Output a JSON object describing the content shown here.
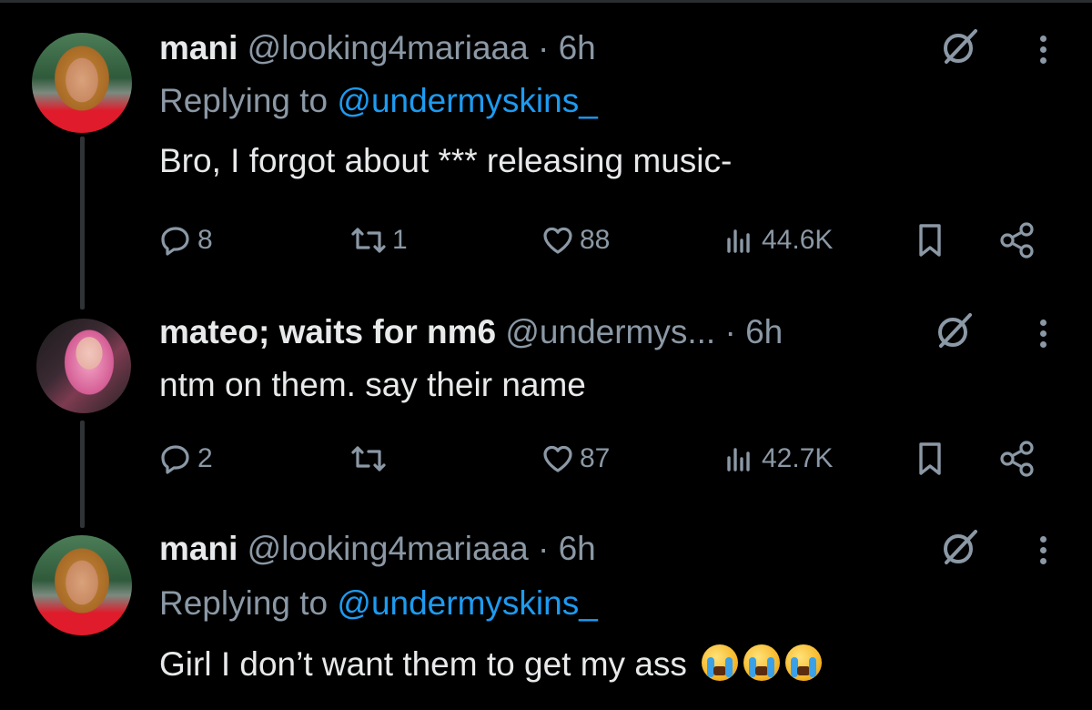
{
  "tweets": [
    {
      "name": "mani",
      "handle": "@looking4mariaaa",
      "dot": "·",
      "time": "6h",
      "replying_prefix": "Replying to",
      "replying_to": "@undermyskins_",
      "text": "Bro, I forgot about *** releasing music-",
      "replies": "8",
      "reposts": "1",
      "likes": "88",
      "views": "44.6K"
    },
    {
      "name": "mateo; waits for nm6",
      "handle": "@undermys...",
      "dot": "·",
      "time": "6h",
      "text": "ntm on them. say their name",
      "replies": "2",
      "reposts": "",
      "likes": "87",
      "views": "42.7K"
    },
    {
      "name": "mani",
      "handle": "@looking4mariaaa",
      "dot": "·",
      "time": "6h",
      "replying_prefix": "Replying to",
      "replying_to": "@undermyskins_",
      "text": "Girl I don’t want them to get my ass",
      "emoji": "loudly-crying-face"
    }
  ],
  "icons": {
    "reply": "reply-icon",
    "repost": "repost-icon",
    "like": "heart-icon",
    "views": "views-icon",
    "bookmark": "bookmark-icon",
    "share": "share-icon",
    "grok": "grok-icon",
    "more": "more-icon"
  },
  "colors": {
    "background": "#000000",
    "text": "#e7e9ea",
    "muted": "#8b98a5",
    "link": "#1d9bf0"
  }
}
